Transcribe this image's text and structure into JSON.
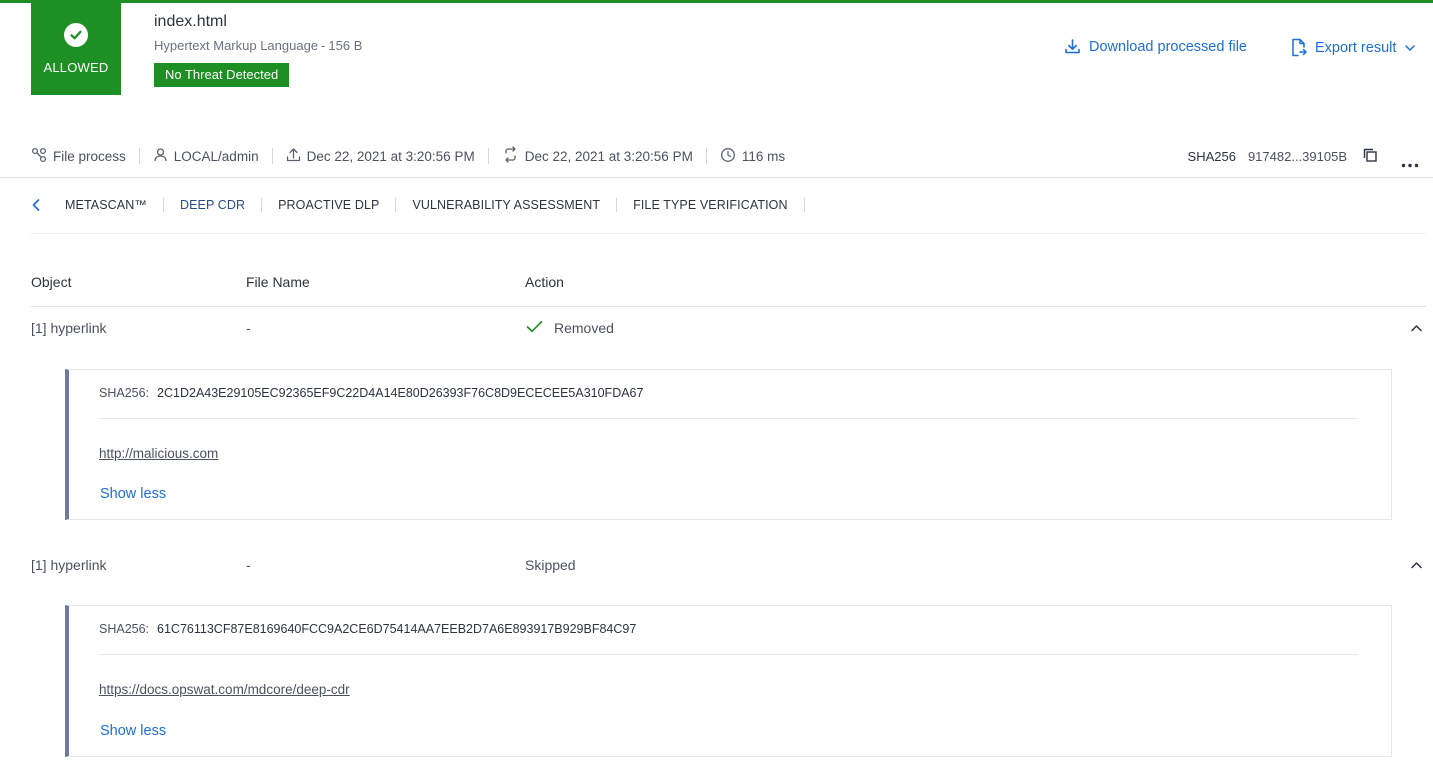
{
  "verdict": {
    "label": "ALLOWED",
    "icon": "check-circle-icon",
    "color": "#1e8f23"
  },
  "file": {
    "name": "index.html",
    "type": "Hypertext Markup Language",
    "separator": "-",
    "size": "156 B",
    "threat_badge": "No Threat Detected"
  },
  "header_actions": {
    "download_label": "Download processed file",
    "export_label": "Export result"
  },
  "info": {
    "workflow": "File process",
    "user": "LOCAL/admin",
    "upload_time": "Dec 22, 2021 at 3:20:56 PM",
    "process_time": "Dec 22, 2021 at 3:20:56 PM",
    "duration": "116 ms",
    "sha_label": "SHA256",
    "sha_value": "917482...39105B"
  },
  "tabs": [
    {
      "label": "METASCAN™",
      "active": false
    },
    {
      "label": "DEEP CDR",
      "active": true
    },
    {
      "label": "PROACTIVE DLP",
      "active": false
    },
    {
      "label": "VULNERABILITY ASSESSMENT",
      "active": false
    },
    {
      "label": "FILE TYPE VERIFICATION",
      "active": false
    }
  ],
  "table": {
    "headers": {
      "object": "Object",
      "file_name": "File Name",
      "action": "Action"
    },
    "rows": [
      {
        "object": "[1] hyperlink",
        "file_name": "-",
        "action": "Removed",
        "action_icon": "check-icon",
        "detail": {
          "sha_label": "SHA256:",
          "sha_value": "2C1D2A43E29105EC92365EF9C22D4A14E80D26393F76C8D9ECECEE5A310FDA67",
          "url": "http://malicious.com",
          "toggle_label": "Show less"
        }
      },
      {
        "object": "[1] hyperlink",
        "file_name": "-",
        "action": "Skipped",
        "action_icon": "",
        "detail": {
          "sha_label": "SHA256:",
          "sha_value": "61C76113CF87E8169640FCC9A2CE6D75414AA7EEB2D7A6E893917B929BF84C97",
          "url": "https://docs.opswat.com/mdcore/deep-cdr",
          "toggle_label": "Show less"
        }
      }
    ]
  },
  "colors": {
    "accent": "#1d6fd8",
    "success": "#1e8f23",
    "detail_border": "#6d7ba3"
  }
}
